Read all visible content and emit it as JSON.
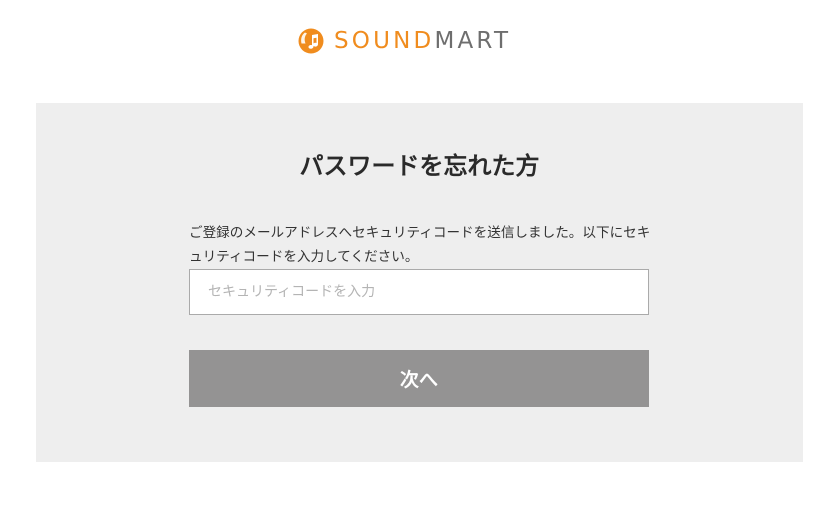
{
  "header": {
    "logo_icon": "music-note-icon",
    "logo_word_sound": "SOUND",
    "logo_word_mart": "MART",
    "colors": {
      "sound": "#f08c1e",
      "mart": "#6e6e6e"
    }
  },
  "main": {
    "title": "パスワードを忘れた方",
    "description": "ご登録のメールアドレスへセキュリティコードを送信しました。以下にセキュリティコードを入力してください。",
    "code_input": {
      "value": "",
      "placeholder": "セキュリティコードを入力"
    },
    "next_button_label": "次へ",
    "colors": {
      "card_background": "#eeeeee",
      "button_background": "#949393"
    }
  }
}
